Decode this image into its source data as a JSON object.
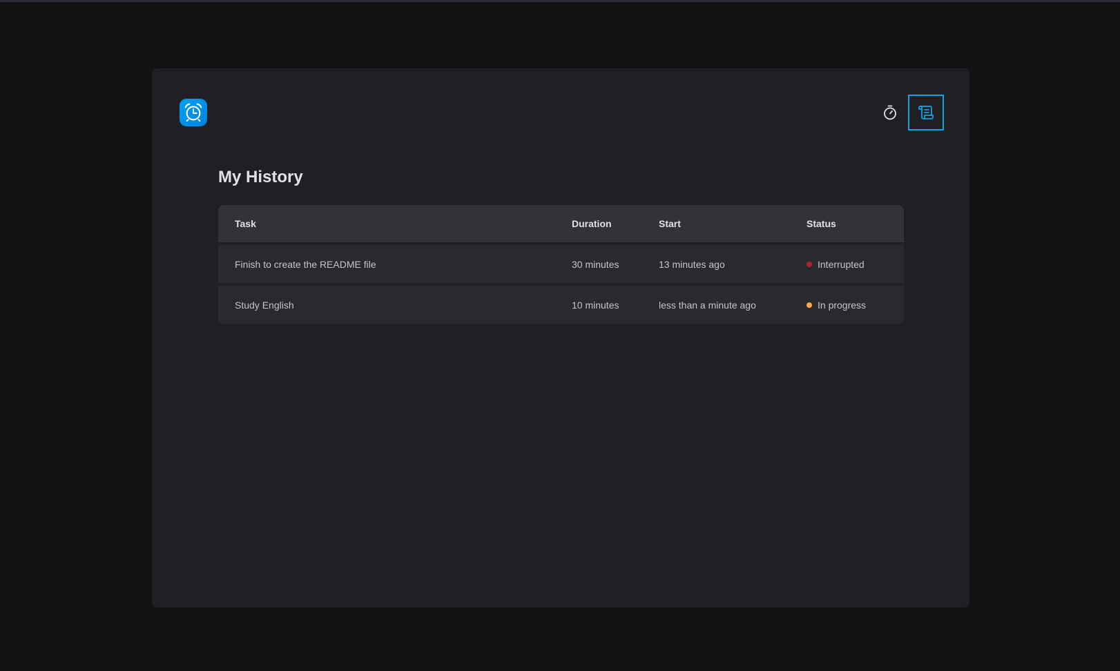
{
  "colors": {
    "accent": "#0ea5e9",
    "status_interrupted": "#ab222e",
    "status_in_progress": "#fba94c"
  },
  "header": {
    "logo_icon": "alarm-clock-icon",
    "nav": [
      {
        "icon": "timer-icon",
        "active": false
      },
      {
        "icon": "scroll-icon",
        "active": true
      }
    ]
  },
  "main": {
    "title": "My History",
    "columns": [
      "Task",
      "Duration",
      "Start",
      "Status"
    ],
    "rows": [
      {
        "task": "Finish to create the README file",
        "duration": "30 minutes",
        "start": "13 minutes ago",
        "status": "Interrupted",
        "status_color": "#ab222e"
      },
      {
        "task": "Study English",
        "duration": "10 minutes",
        "start": "less than a minute ago",
        "status": "In progress",
        "status_color": "#fba94c"
      }
    ]
  }
}
